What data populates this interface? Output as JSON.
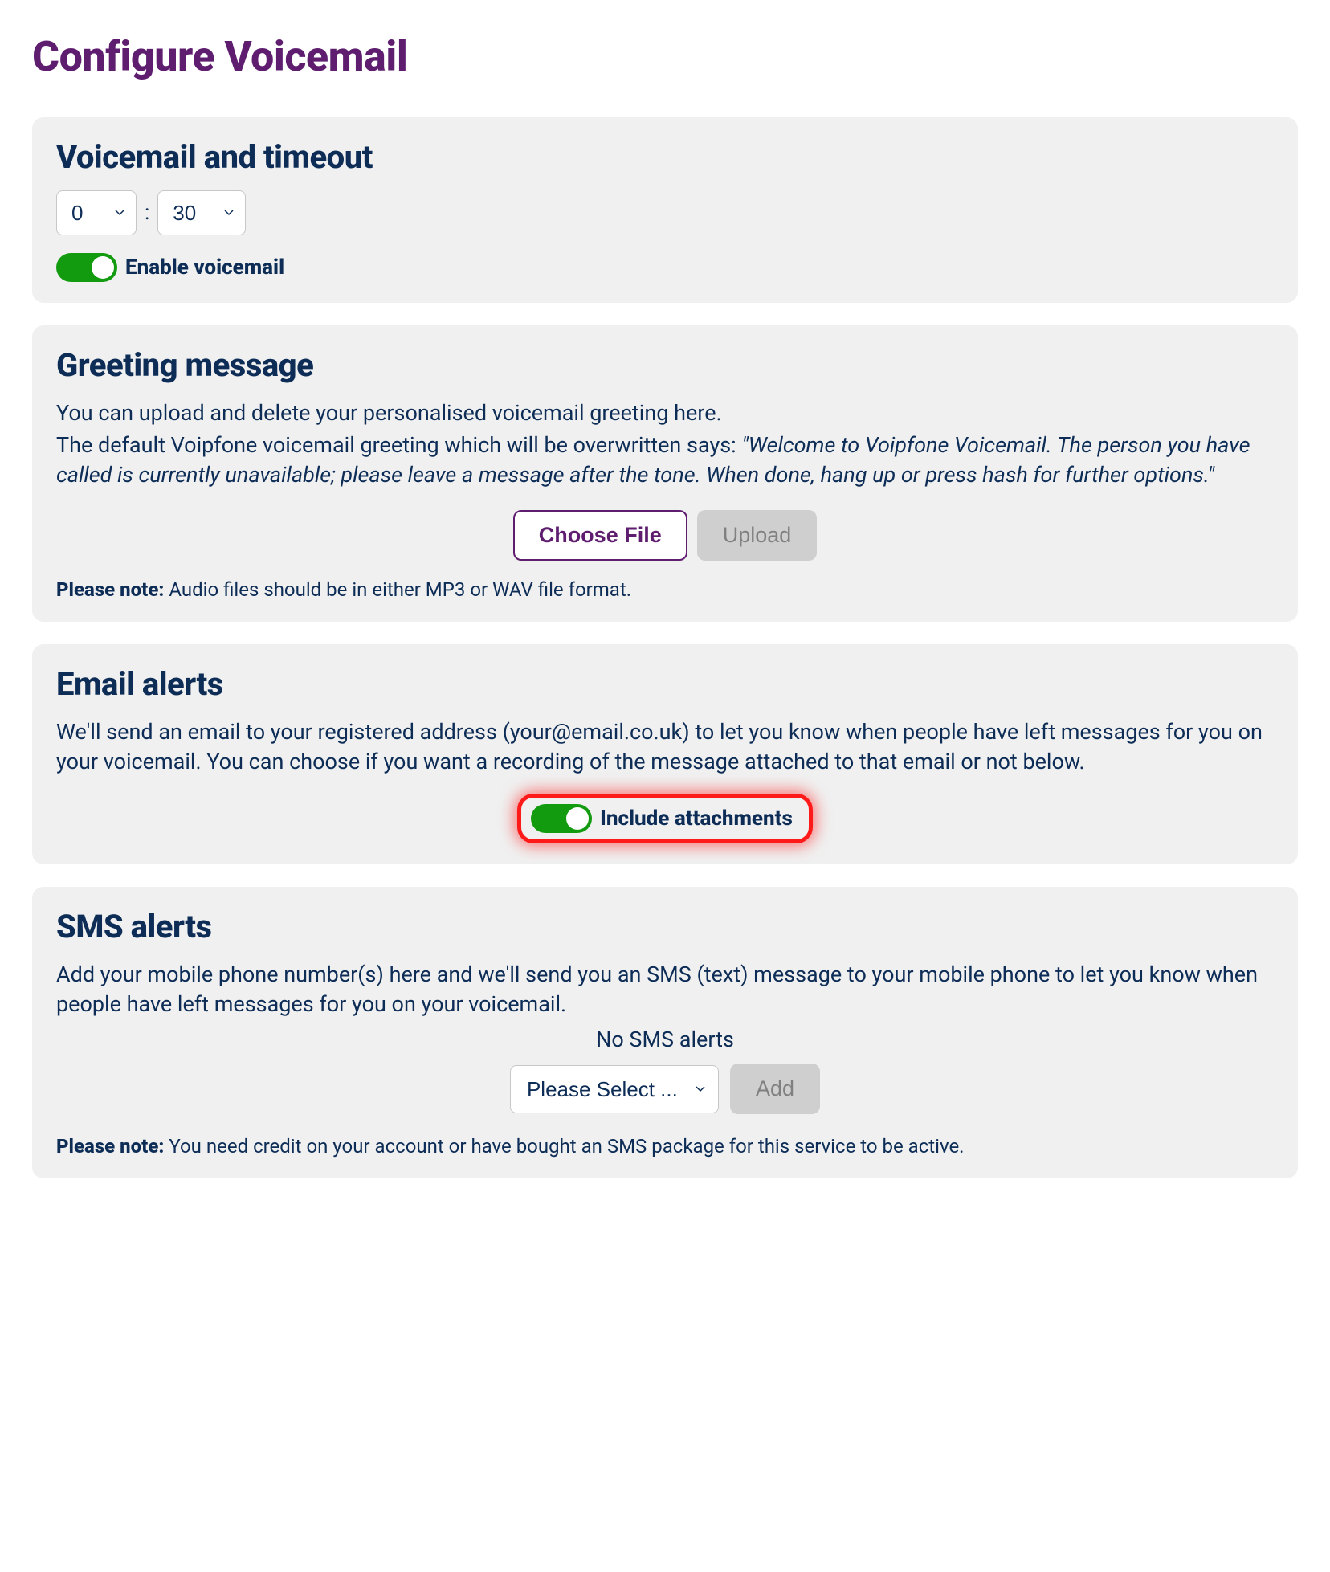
{
  "page_title": "Configure Voicemail",
  "timeout_section": {
    "heading": "Voicemail and timeout",
    "minutes": "0",
    "seconds": "30",
    "separator": ":",
    "enable_toggle_label": "Enable voicemail",
    "enable_toggle_on": true
  },
  "greeting_section": {
    "heading": "Greeting message",
    "line1": "You can upload and delete your personalised voicemail greeting here.",
    "line2_prefix": "The default Voipfone voicemail greeting which will be overwritten says: ",
    "line2_quote": "\"Welcome to Voipfone Voicemail. The person you have called is currently unavailable; please leave a message after the tone. When done, hang up or press hash for further options.\"",
    "choose_file_label": "Choose File",
    "upload_label": "Upload",
    "note_label": "Please note:",
    "note_text": " Audio files should be in either MP3 or WAV file format."
  },
  "email_section": {
    "heading": "Email alerts",
    "desc": "We'll send an email to your registered address (your@email.co.uk) to let you know when people have left messages for you on your voicemail. You can choose if you want a recording of the message attached to that email or not below.",
    "toggle_label": "Include attachments",
    "toggle_on": true,
    "highlighted": true
  },
  "sms_section": {
    "heading": "SMS alerts",
    "desc": "Add your mobile phone number(s) here and we'll send you an SMS (text) message to your mobile phone to let you know when people have left messages for you on your voicemail.",
    "status": "No SMS alerts",
    "select_placeholder": "Please Select ...",
    "add_label": "Add",
    "note_label": "Please note:",
    "note_text": " You need credit on your account or have bought an SMS package for this service to be active."
  }
}
